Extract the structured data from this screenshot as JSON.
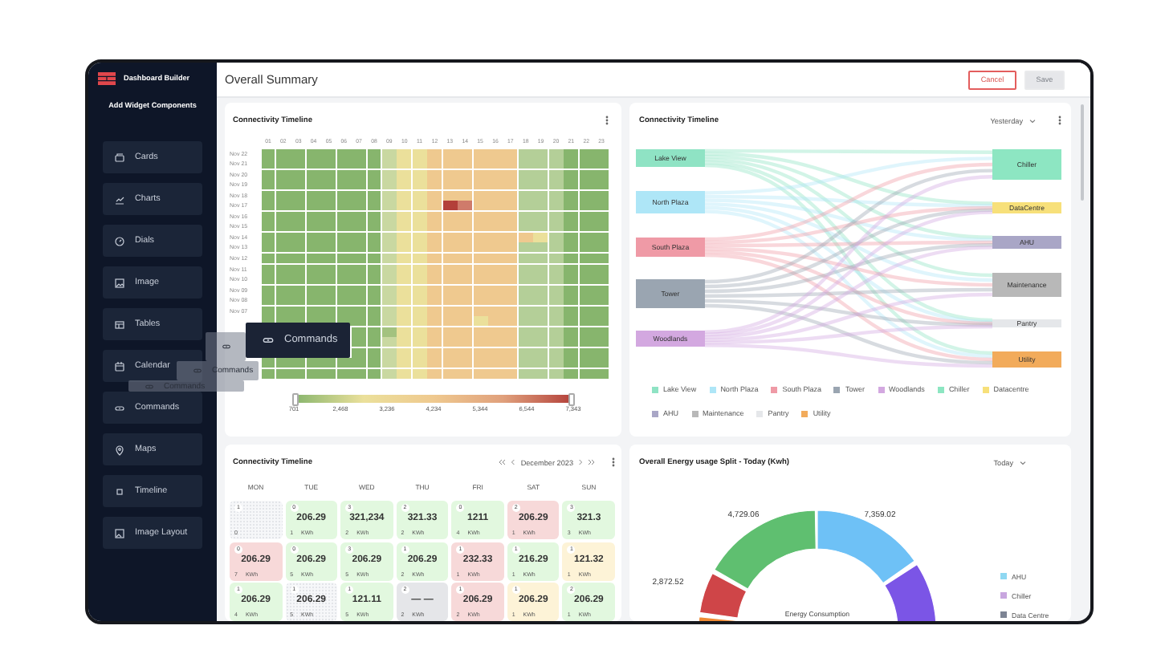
{
  "sidebar": {
    "app_title": "Dashboard Builder",
    "section_title": "Add Widget Components",
    "items": [
      {
        "label": "Cards",
        "kind": "cards"
      },
      {
        "label": "Charts",
        "kind": "charts"
      },
      {
        "label": "Dials",
        "kind": "dials"
      },
      {
        "label": "Image",
        "kind": "image"
      },
      {
        "label": "Tables",
        "kind": "tables"
      },
      {
        "label": "Calendar",
        "kind": "calendar"
      },
      {
        "label": "Commands",
        "kind": "commands"
      },
      {
        "label": "Maps",
        "kind": "maps"
      },
      {
        "label": "Timeline",
        "kind": "timeline"
      },
      {
        "label": "Image Layout",
        "kind": "layout"
      }
    ]
  },
  "header": {
    "title": "Overall Summary",
    "buttons": [
      {
        "label": "Cancel",
        "kind": "cancel",
        "disabled": false
      },
      {
        "label": "Save",
        "kind": "save",
        "disabled": true
      }
    ]
  },
  "heatmap_card": {
    "title": "Connectivity Timeline",
    "columns": [
      "01",
      "02",
      "03",
      "04",
      "05",
      "06",
      "07",
      "08",
      "09",
      "10",
      "11",
      "12",
      "13",
      "14",
      "15",
      "16",
      "17",
      "18",
      "19",
      "20",
      "21",
      "22",
      "23"
    ],
    "rows": [
      {
        "label": "Nov 22",
        "cells": [
          {
            "color": "#87b56d"
          },
          {
            "color": "#87b56d"
          },
          {
            "color": "#87b56d"
          },
          {
            "color": "#87b56d"
          },
          {
            "color": "#87b56d"
          },
          {
            "color": "#87b56d"
          },
          {
            "color": "#87b56d"
          },
          {
            "color": "#87b56d"
          },
          {
            "color": "#c9d8a1"
          },
          {
            "color": "#ebe09b"
          },
          {
            "color": "#ebe09b"
          },
          {
            "color": "#efc98f"
          },
          {
            "color": "#efc98f"
          },
          {
            "color": "#efc98f"
          },
          {
            "color": "#efc98f"
          },
          {
            "color": "#efc98f"
          },
          {
            "color": "#efc98f"
          },
          {
            "color": "#b4cf98"
          },
          {
            "color": "#b4cf98"
          },
          {
            "color": "#b4cf98"
          },
          {
            "color": "#87b56d"
          },
          {
            "color": "#87b56d"
          },
          {
            "color": "#87b56d"
          }
        ]
      },
      {
        "label": "Nov 21",
        "cells": [
          {
            "color": "#87b56d"
          },
          {
            "color": "#87b56d"
          },
          {
            "color": "#87b56d"
          },
          {
            "color": "#87b56d"
          },
          {
            "color": "#87b56d"
          },
          {
            "color": "#87b56d"
          },
          {
            "color": "#87b56d"
          },
          {
            "color": "#87b56d"
          },
          {
            "color": "#c9d8a1"
          },
          {
            "color": "#ebe09b"
          },
          {
            "color": "#ebe09b"
          },
          {
            "color": "#efc98f"
          },
          {
            "color": "#efc98f"
          },
          {
            "color": "#efc98f"
          },
          {
            "color": "#efc98f"
          },
          {
            "color": "#efc98f"
          },
          {
            "color": "#efc98f"
          },
          {
            "color": "#b4cf98"
          },
          {
            "color": "#b4cf98"
          },
          {
            "color": "#b4cf98"
          },
          {
            "color": "#87b56d"
          },
          {
            "color": "#87b56d"
          },
          {
            "color": "#87b56d"
          }
        ]
      },
      {
        "label": "Nov 20",
        "cells": [
          {
            "color": "#87b56d"
          },
          {
            "color": "#87b56d"
          },
          {
            "color": "#87b56d"
          },
          {
            "color": "#87b56d"
          },
          {
            "color": "#87b56d"
          },
          {
            "color": "#87b56d"
          },
          {
            "color": "#87b56d"
          },
          {
            "color": "#87b56d"
          },
          {
            "color": "#c9d8a1"
          },
          {
            "color": "#ebe09b"
          },
          {
            "color": "#ebe09b"
          },
          {
            "color": "#efc98f"
          },
          {
            "color": "#efc98f"
          },
          {
            "color": "#efc98f"
          },
          {
            "color": "#efc98f"
          },
          {
            "color": "#efc98f"
          },
          {
            "color": "#efc98f"
          },
          {
            "color": "#b4cf98"
          },
          {
            "color": "#b4cf98"
          },
          {
            "color": "#b4cf98"
          },
          {
            "color": "#87b56d"
          },
          {
            "color": "#87b56d"
          },
          {
            "color": "#87b56d"
          }
        ]
      },
      {
        "label": "Nov 19",
        "cells": [
          {
            "color": "#87b56d"
          },
          {
            "color": "#87b56d"
          },
          {
            "color": "#87b56d"
          },
          {
            "color": "#87b56d"
          },
          {
            "color": "#87b56d"
          },
          {
            "color": "#87b56d"
          },
          {
            "color": "#87b56d"
          },
          {
            "color": "#87b56d"
          },
          {
            "color": "#c9d8a1"
          },
          {
            "color": "#ebe09b"
          },
          {
            "color": "#ebe09b"
          },
          {
            "color": "#efc98f"
          },
          {
            "color": "#efc98f"
          },
          {
            "color": "#efc98f"
          },
          {
            "color": "#efc98f"
          },
          {
            "color": "#efc98f"
          },
          {
            "color": "#efc98f"
          },
          {
            "color": "#b4cf98"
          },
          {
            "color": "#b4cf98"
          },
          {
            "color": "#b4cf98"
          },
          {
            "color": "#87b56d"
          },
          {
            "color": "#87b56d"
          },
          {
            "color": "#87b56d"
          }
        ]
      },
      {
        "label": "Nov 18",
        "cells": [
          {
            "color": "#87b56d"
          },
          {
            "color": "#87b56d"
          },
          {
            "color": "#87b56d"
          },
          {
            "color": "#87b56d"
          },
          {
            "color": "#87b56d"
          },
          {
            "color": "#87b56d"
          },
          {
            "color": "#87b56d"
          },
          {
            "color": "#87b56d"
          },
          {
            "color": "#c9d8a1"
          },
          {
            "color": "#ebe09b"
          },
          {
            "color": "#ebe09b"
          },
          {
            "color": "#efc98f"
          },
          {
            "color": "#efc98f"
          },
          {
            "color": "#efc98f"
          },
          {
            "color": "#efc98f"
          },
          {
            "color": "#efc98f"
          },
          {
            "color": "#efc98f"
          },
          {
            "color": "#b4cf98"
          },
          {
            "color": "#b4cf98"
          },
          {
            "color": "#b4cf98"
          },
          {
            "color": "#87b56d"
          },
          {
            "color": "#87b56d"
          },
          {
            "color": "#87b56d"
          }
        ]
      },
      {
        "label": "Nov 17",
        "cells": [
          {
            "color": "#87b56d"
          },
          {
            "color": "#87b56d"
          },
          {
            "color": "#87b56d"
          },
          {
            "color": "#87b56d"
          },
          {
            "color": "#87b56d"
          },
          {
            "color": "#87b56d"
          },
          {
            "color": "#87b56d"
          },
          {
            "color": "#87b56d"
          },
          {
            "color": "#c9d8a1"
          },
          {
            "color": "#ebe09b"
          },
          {
            "color": "#ebe09b"
          },
          {
            "color": "#efc98f"
          },
          {
            "color": "#b3403a"
          },
          {
            "color": "#cf7b6b"
          },
          {
            "color": "#efc98f"
          },
          {
            "color": "#efc98f"
          },
          {
            "color": "#efc98f"
          },
          {
            "color": "#b4cf98"
          },
          {
            "color": "#b4cf98"
          },
          {
            "color": "#b4cf98"
          },
          {
            "color": "#87b56d"
          },
          {
            "color": "#87b56d"
          },
          {
            "color": "#87b56d"
          }
        ]
      },
      {
        "label": "Nov 16",
        "cells": [
          {
            "color": "#87b56d"
          },
          {
            "color": "#87b56d"
          },
          {
            "color": "#87b56d"
          },
          {
            "color": "#87b56d"
          },
          {
            "color": "#87b56d"
          },
          {
            "color": "#87b56d"
          },
          {
            "color": "#87b56d"
          },
          {
            "color": "#87b56d"
          },
          {
            "color": "#c9d8a1"
          },
          {
            "color": "#ebe09b"
          },
          {
            "color": "#ebe09b"
          },
          {
            "color": "#efc98f"
          },
          {
            "color": "#efc98f"
          },
          {
            "color": "#efc98f"
          },
          {
            "color": "#efc98f"
          },
          {
            "color": "#efc98f"
          },
          {
            "color": "#efc98f"
          },
          {
            "color": "#b4cf98"
          },
          {
            "color": "#b4cf98"
          },
          {
            "color": "#b4cf98"
          },
          {
            "color": "#87b56d"
          },
          {
            "color": "#87b56d"
          },
          {
            "color": "#87b56d"
          }
        ]
      },
      {
        "label": "Nov 15",
        "cells": [
          {
            "color": "#87b56d"
          },
          {
            "color": "#87b56d"
          },
          {
            "color": "#87b56d"
          },
          {
            "color": "#87b56d"
          },
          {
            "color": "#87b56d"
          },
          {
            "color": "#87b56d"
          },
          {
            "color": "#87b56d"
          },
          {
            "color": "#87b56d"
          },
          {
            "color": "#c9d8a1"
          },
          {
            "color": "#ebe09b"
          },
          {
            "color": "#ebe09b"
          },
          {
            "color": "#efc98f"
          },
          {
            "color": "#efc98f"
          },
          {
            "color": "#efc98f"
          },
          {
            "color": "#efc98f"
          },
          {
            "color": "#efc98f"
          },
          {
            "color": "#efc98f"
          },
          {
            "color": "#b4cf98"
          },
          {
            "color": "#b4cf98"
          },
          {
            "color": "#b4cf98"
          },
          {
            "color": "#87b56d"
          },
          {
            "color": "#87b56d"
          },
          {
            "color": "#87b56d"
          }
        ]
      },
      {
        "label": "Nov 14",
        "cells": [
          {
            "color": "#87b56d"
          },
          {
            "color": "#87b56d"
          },
          {
            "color": "#87b56d"
          },
          {
            "color": "#87b56d"
          },
          {
            "color": "#87b56d"
          },
          {
            "color": "#87b56d"
          },
          {
            "color": "#87b56d"
          },
          {
            "color": "#87b56d"
          },
          {
            "color": "#c9d8a1"
          },
          {
            "color": "#ebe09b"
          },
          {
            "color": "#ebe09b"
          },
          {
            "color": "#efc98f"
          },
          {
            "color": "#efc98f"
          },
          {
            "color": "#efc98f"
          },
          {
            "color": "#efc98f"
          },
          {
            "color": "#efc98f"
          },
          {
            "color": "#efc98f"
          },
          {
            "color": "#efc98f"
          },
          {
            "color": "#ebe09b"
          },
          {
            "color": "#b4cf98"
          },
          {
            "color": "#87b56d"
          },
          {
            "color": "#87b56d"
          },
          {
            "color": "#87b56d"
          }
        ]
      },
      {
        "label": "Nov 13",
        "cells": [
          {
            "color": "#87b56d"
          },
          {
            "color": "#87b56d"
          },
          {
            "color": "#87b56d"
          },
          {
            "color": "#87b56d"
          },
          {
            "color": "#87b56d"
          },
          {
            "color": "#87b56d"
          },
          {
            "color": "#87b56d"
          },
          {
            "color": "#87b56d"
          },
          {
            "color": "#c9d8a1"
          },
          {
            "color": "#ebe09b"
          },
          {
            "color": "#ebe09b"
          },
          {
            "color": "#efc98f"
          },
          {
            "color": "#efc98f"
          },
          {
            "color": "#efc98f"
          },
          {
            "color": "#efc98f"
          },
          {
            "color": "#efc98f"
          },
          {
            "color": "#efc98f"
          },
          {
            "color": "#b4cf98"
          },
          {
            "color": "#b4cf98"
          },
          {
            "color": "#b4cf98"
          },
          {
            "color": "#87b56d"
          },
          {
            "color": "#87b56d"
          },
          {
            "color": "#87b56d"
          }
        ]
      },
      {
        "label": "Nov 12",
        "cells": [
          {
            "color": "#87b56d"
          },
          {
            "color": "#87b56d"
          },
          {
            "color": "#87b56d"
          },
          {
            "color": "#87b56d"
          },
          {
            "color": "#87b56d"
          },
          {
            "color": "#87b56d"
          },
          {
            "color": "#87b56d"
          },
          {
            "color": "#87b56d"
          },
          {
            "color": "#c9d8a1"
          },
          {
            "color": "#ebe09b"
          },
          {
            "color": "#ebe09b"
          },
          {
            "color": "#efc98f"
          },
          {
            "color": "#efc98f"
          },
          {
            "color": "#efc98f"
          },
          {
            "color": "#efc98f"
          },
          {
            "color": "#efc98f"
          },
          {
            "color": "#efc98f"
          },
          {
            "color": "#b4cf98"
          },
          {
            "color": "#b4cf98"
          },
          {
            "color": "#b4cf98"
          },
          {
            "color": "#87b56d"
          },
          {
            "color": "#87b56d"
          },
          {
            "color": "#87b56d"
          }
        ]
      },
      {
        "label": "Nov 11",
        "cells": [
          {
            "color": "#87b56d"
          },
          {
            "color": "#87b56d"
          },
          {
            "color": "#87b56d"
          },
          {
            "color": "#87b56d"
          },
          {
            "color": "#87b56d"
          },
          {
            "color": "#87b56d"
          },
          {
            "color": "#87b56d"
          },
          {
            "color": "#87b56d"
          },
          {
            "color": "#c9d8a1"
          },
          {
            "color": "#ebe09b"
          },
          {
            "color": "#ebe09b"
          },
          {
            "color": "#efc98f"
          },
          {
            "color": "#efc98f"
          },
          {
            "color": "#efc98f"
          },
          {
            "color": "#efc98f"
          },
          {
            "color": "#efc98f"
          },
          {
            "color": "#efc98f"
          },
          {
            "color": "#b4cf98"
          },
          {
            "color": "#b4cf98"
          },
          {
            "color": "#b4cf98"
          },
          {
            "color": "#87b56d"
          },
          {
            "color": "#87b56d"
          },
          {
            "color": "#87b56d"
          }
        ]
      },
      {
        "label": "Nov 10",
        "cells": [
          {
            "color": "#87b56d"
          },
          {
            "color": "#87b56d"
          },
          {
            "color": "#87b56d"
          },
          {
            "color": "#87b56d"
          },
          {
            "color": "#87b56d"
          },
          {
            "color": "#87b56d"
          },
          {
            "color": "#87b56d"
          },
          {
            "color": "#87b56d"
          },
          {
            "color": "#c9d8a1"
          },
          {
            "color": "#ebe09b"
          },
          {
            "color": "#ebe09b"
          },
          {
            "color": "#efc98f"
          },
          {
            "color": "#efc98f"
          },
          {
            "color": "#efc98f"
          },
          {
            "color": "#efc98f"
          },
          {
            "color": "#efc98f"
          },
          {
            "color": "#efc98f"
          },
          {
            "color": "#b4cf98"
          },
          {
            "color": "#b4cf98"
          },
          {
            "color": "#b4cf98"
          },
          {
            "color": "#87b56d"
          },
          {
            "color": "#87b56d"
          },
          {
            "color": "#87b56d"
          }
        ]
      },
      {
        "label": "Nov 09",
        "cells": [
          {
            "color": "#87b56d"
          },
          {
            "color": "#87b56d"
          },
          {
            "color": "#87b56d"
          },
          {
            "color": "#87b56d"
          },
          {
            "color": "#87b56d"
          },
          {
            "color": "#87b56d"
          },
          {
            "color": "#87b56d"
          },
          {
            "color": "#87b56d"
          },
          {
            "color": "#c9d8a1"
          },
          {
            "color": "#ebe09b"
          },
          {
            "color": "#ebe09b"
          },
          {
            "color": "#efc98f"
          },
          {
            "color": "#efc98f"
          },
          {
            "color": "#efc98f"
          },
          {
            "color": "#efc98f"
          },
          {
            "color": "#efc98f"
          },
          {
            "color": "#efc98f"
          },
          {
            "color": "#b4cf98"
          },
          {
            "color": "#b4cf98"
          },
          {
            "color": "#b4cf98"
          },
          {
            "color": "#87b56d"
          },
          {
            "color": "#87b56d"
          },
          {
            "color": "#87b56d"
          }
        ]
      },
      {
        "label": "Nov 08",
        "cells": [
          {
            "color": "#87b56d"
          },
          {
            "color": "#87b56d"
          },
          {
            "color": "#87b56d"
          },
          {
            "color": "#87b56d"
          },
          {
            "color": "#87b56d"
          },
          {
            "color": "#87b56d"
          },
          {
            "color": "#87b56d"
          },
          {
            "color": "#87b56d"
          },
          {
            "color": "#c9d8a1"
          },
          {
            "color": "#ebe09b"
          },
          {
            "color": "#ebe09b"
          },
          {
            "color": "#efc98f"
          },
          {
            "color": "#efc98f"
          },
          {
            "color": "#efc98f"
          },
          {
            "color": "#efc98f"
          },
          {
            "color": "#efc98f"
          },
          {
            "color": "#efc98f"
          },
          {
            "color": "#b4cf98"
          },
          {
            "color": "#b4cf98"
          },
          {
            "color": "#b4cf98"
          },
          {
            "color": "#87b56d"
          },
          {
            "color": "#87b56d"
          },
          {
            "color": "#87b56d"
          }
        ]
      },
      {
        "label": "Nov 07",
        "cells": [
          {
            "color": "#87b56d"
          },
          {
            "color": "#87b56d"
          },
          {
            "color": "#87b56d"
          },
          {
            "color": "#87b56d"
          },
          {
            "color": "#87b56d"
          },
          {
            "color": "#87b56d"
          },
          {
            "color": "#87b56d"
          },
          {
            "color": "#87b56d"
          },
          {
            "color": "#c9d8a1"
          },
          {
            "color": "#ebe09b"
          },
          {
            "color": "#ebe09b"
          },
          {
            "color": "#efc98f"
          },
          {
            "color": "#efc98f"
          },
          {
            "color": "#efc98f"
          },
          {
            "color": "#efc98f"
          },
          {
            "color": "#efc98f"
          },
          {
            "color": "#efc98f"
          },
          {
            "color": "#b4cf98"
          },
          {
            "color": "#b4cf98"
          },
          {
            "color": "#b4cf98"
          },
          {
            "color": "#87b56d"
          },
          {
            "color": "#87b56d"
          },
          {
            "color": "#87b56d"
          }
        ]
      },
      {
        "cells": [
          {
            "color": "#87b56d"
          },
          {
            "color": "#87b56d"
          },
          {
            "color": "#87b56d"
          },
          {
            "color": "#87b56d"
          },
          {
            "color": "#87b56d"
          },
          {
            "color": "#87b56d"
          },
          {
            "color": "#87b56d"
          },
          {
            "color": "#87b56d"
          },
          {
            "color": "#c9d8a1"
          },
          {
            "color": "#ebe09b"
          },
          {
            "color": "#ebe09b"
          },
          {
            "color": "#efc98f"
          },
          {
            "color": "#efc98f"
          },
          {
            "color": "#efc98f"
          },
          {
            "color": "#ebe09b"
          },
          {
            "color": "#efc98f"
          },
          {
            "color": "#efc98f"
          },
          {
            "color": "#b4cf98"
          },
          {
            "color": "#b4cf98"
          },
          {
            "color": "#b4cf98"
          },
          {
            "color": "#87b56d"
          },
          {
            "color": "#87b56d"
          },
          {
            "color": "#87b56d"
          }
        ]
      },
      {
        "cells": [
          null,
          null,
          null,
          null,
          null,
          null,
          {
            "color": "#87b56d"
          },
          {
            "color": "#87b56d"
          },
          {
            "color": "#a3c27f"
          },
          {
            "color": "#ebe09b"
          },
          {
            "color": "#ebe09b"
          },
          {
            "color": "#efc98f"
          },
          {
            "color": "#efc98f"
          },
          {
            "color": "#efc98f"
          },
          {
            "color": "#efc98f"
          },
          {
            "color": "#efc98f"
          },
          {
            "color": "#efc98f"
          },
          {
            "color": "#b4cf98"
          },
          {
            "color": "#b4cf98"
          },
          {
            "color": "#b4cf98"
          },
          {
            "color": "#87b56d"
          },
          {
            "color": "#87b56d"
          },
          {
            "color": "#87b56d"
          }
        ]
      },
      {
        "cells": [
          null,
          null,
          null,
          null,
          null,
          null,
          {
            "color": "#87b56d"
          },
          {
            "color": "#87b56d"
          },
          {
            "color": "#c9d8a1"
          },
          {
            "color": "#ebe09b"
          },
          {
            "color": "#ebe09b"
          },
          {
            "color": "#efc98f"
          },
          {
            "color": "#efc98f"
          },
          {
            "color": "#efc98f"
          },
          {
            "color": "#efc98f"
          },
          {
            "color": "#efc98f"
          },
          {
            "color": "#efc98f"
          },
          {
            "color": "#b4cf98"
          },
          {
            "color": "#b4cf98"
          },
          {
            "color": "#b4cf98"
          },
          {
            "color": "#87b56d"
          },
          {
            "color": "#87b56d"
          },
          {
            "color": "#87b56d"
          }
        ]
      },
      {
        "cells": [
          null,
          null,
          null,
          null,
          null,
          null,
          {
            "color": "#87b56d"
          },
          {
            "color": "#87b56d"
          },
          {
            "color": "#c9d8a1"
          },
          {
            "color": "#ebe09b"
          },
          {
            "color": "#ebe09b"
          },
          {
            "color": "#efc98f"
          },
          {
            "color": "#efc98f"
          },
          {
            "color": "#efc98f"
          },
          {
            "color": "#efc98f"
          },
          {
            "color": "#efc98f"
          },
          {
            "color": "#efc98f"
          },
          {
            "color": "#b4cf98"
          },
          {
            "color": "#b4cf98"
          },
          {
            "color": "#b4cf98"
          },
          {
            "color": "#87b56d"
          },
          {
            "color": "#87b56d"
          },
          {
            "color": "#87b56d"
          }
        ]
      },
      {
        "cells": [
          {
            "color": "#87b56d"
          },
          {
            "color": "#87b56d"
          },
          {
            "color": "#87b56d"
          },
          {
            "color": "#87b56d"
          },
          {
            "color": "#87b56d"
          },
          {
            "color": "#87b56d"
          },
          {
            "color": "#87b56d"
          },
          {
            "color": "#87b56d"
          },
          {
            "color": "#c9d8a1"
          },
          {
            "color": "#ebe09b"
          },
          {
            "color": "#ebe09b"
          },
          {
            "color": "#efc98f"
          },
          {
            "color": "#efc98f"
          },
          {
            "color": "#efc98f"
          },
          {
            "color": "#efc98f"
          },
          {
            "color": "#efc98f"
          },
          {
            "color": "#efc98f"
          },
          {
            "color": "#b4cf98"
          },
          {
            "color": "#b4cf98"
          },
          {
            "color": "#b4cf98"
          },
          {
            "color": "#87b56d"
          },
          {
            "color": "#87b56d"
          },
          {
            "color": "#87b56d"
          }
        ]
      },
      {
        "cells": [
          {
            "color": "#87b56d"
          },
          {
            "color": "#87b56d"
          },
          {
            "color": "#87b56d"
          },
          {
            "color": "#87b56d"
          },
          {
            "color": "#87b56d"
          },
          {
            "color": "#87b56d"
          },
          {
            "color": "#87b56d"
          },
          {
            "color": "#87b56d"
          },
          {
            "color": "#c9d8a1"
          },
          {
            "color": "#ebe09b"
          },
          {
            "color": "#ebe09b"
          },
          {
            "color": "#efc98f"
          },
          {
            "color": "#efc98f"
          },
          {
            "color": "#efc98f"
          },
          {
            "color": "#efc98f"
          },
          {
            "color": "#efc98f"
          },
          {
            "color": "#efc98f"
          },
          {
            "color": "#b4cf98"
          },
          {
            "color": "#b4cf98"
          },
          {
            "color": "#b4cf98"
          },
          {
            "color": "#87b56d"
          },
          {
            "color": "#87b56d"
          },
          {
            "color": "#87b56d"
          }
        ]
      }
    ],
    "scale": {
      "ticks": [
        "701",
        "2,468",
        "3,236",
        "4,234",
        "5,344",
        "6,544",
        "7,343"
      ]
    }
  },
  "sankey_card": {
    "title": "Connectivity Timeline",
    "period": "Yesterday",
    "sources": [
      {
        "label": "Lake View",
        "color": "#8fe3c4"
      },
      {
        "label": "North Plaza",
        "color": "#aee6f7"
      },
      {
        "label": "South Plaza",
        "color": "#ef9aa6"
      },
      {
        "label": "Tower",
        "color": "#9aa5b1"
      },
      {
        "label": "Woodlands",
        "color": "#d3a8e0"
      }
    ],
    "targets": [
      {
        "label": "Chiller",
        "color": "#8de6c2"
      },
      {
        "label": "DataCentre",
        "color": "#f7e07a"
      },
      {
        "label": "AHU",
        "color": "#a9a6c6"
      },
      {
        "label": "Maintenance",
        "color": "#b8b8b8"
      },
      {
        "label": "Pantry",
        "color": "#e5e7ea"
      },
      {
        "label": "Utility",
        "color": "#f2ab5b"
      }
    ],
    "legend": [
      {
        "label": "Lake View",
        "color": "#8fe3c4"
      },
      {
        "label": "North Plaza",
        "color": "#aee6f7"
      },
      {
        "label": "South Plaza",
        "color": "#ef9aa6"
      },
      {
        "label": "Tower",
        "color": "#9aa5b1"
      },
      {
        "label": "Woodlands",
        "color": "#d3a8e0"
      },
      {
        "label": "Chiller",
        "color": "#8de6c2"
      },
      {
        "label": "Datacentre",
        "color": "#f7e07a"
      },
      {
        "label": "AHU",
        "color": "#a9a6c6"
      },
      {
        "label": "Maintenance",
        "color": "#b8b8b8"
      },
      {
        "label": "Pantry",
        "color": "#e5e7ea"
      },
      {
        "label": "Utility",
        "color": "#f2ab5b"
      }
    ]
  },
  "calendar_card": {
    "title": "Connectivity Timeline",
    "month": "December 2023",
    "weekdays": [
      "MON",
      "TUE",
      "WED",
      "THU",
      "FRI",
      "SAT",
      "SUN"
    ],
    "weeks": [
      {
        "days": [
          {
            "day": "1",
            "count": "0",
            "kind": "empty"
          },
          {
            "day": "0",
            "value": "206.29",
            "count": "1",
            "unit": "KWh",
            "kind": "normal"
          },
          {
            "day": "3",
            "value": "321,234",
            "count": "2",
            "unit": "KWh",
            "kind": "normal"
          },
          {
            "day": "2",
            "value": "321.33",
            "count": "2",
            "unit": "KWh",
            "kind": "normal"
          },
          {
            "day": "0",
            "value": "1211",
            "count": "4",
            "unit": "KWh",
            "kind": "normal"
          },
          {
            "day": "2",
            "value": "206.29",
            "count": "1",
            "unit": "KWh",
            "kind": "high"
          },
          {
            "day": "3",
            "value": "321.3",
            "count": "3",
            "unit": "KWh",
            "kind": "normal"
          }
        ]
      },
      {
        "days": [
          {
            "day": "0",
            "value": "206.29",
            "count": "7",
            "unit": "KWh",
            "kind": "high"
          },
          {
            "day": "0",
            "value": "206.29",
            "count": "5",
            "unit": "KWh",
            "kind": "normal"
          },
          {
            "day": "3",
            "value": "206.29",
            "count": "5",
            "unit": "KWh",
            "kind": "normal"
          },
          {
            "day": "1",
            "value": "206.29",
            "count": "2",
            "unit": "KWh",
            "kind": "normal"
          },
          {
            "day": "1",
            "value": "232.33",
            "count": "1",
            "unit": "KWh",
            "kind": "high"
          },
          {
            "day": "1",
            "value": "216.29",
            "count": "1",
            "unit": "KWh",
            "kind": "normal"
          },
          {
            "day": "1",
            "value": "121.32",
            "count": "1",
            "unit": "KWh",
            "kind": "warning"
          }
        ]
      },
      {
        "days": [
          {
            "day": "1",
            "value": "206.29",
            "count": "4",
            "unit": "KWh",
            "kind": "normal"
          },
          {
            "day": "1",
            "value": "206.29",
            "count": "5",
            "unit": "KWh",
            "kind": "empty"
          },
          {
            "day": "1",
            "value": "121.11",
            "count": "5",
            "unit": "KWh",
            "kind": "normal"
          },
          {
            "day": "2",
            "value": "— —",
            "count": "2",
            "unit": "KWh",
            "kind": "none"
          },
          {
            "day": "1",
            "value": "206.29",
            "count": "2",
            "unit": "KWh",
            "kind": "high"
          },
          {
            "day": "1",
            "value": "206.29",
            "count": "1",
            "unit": "KWh",
            "kind": "warning"
          },
          {
            "day": "2",
            "value": "206.29",
            "count": "1",
            "unit": "KWh",
            "kind": "normal"
          }
        ]
      }
    ]
  },
  "donut_card": {
    "title": "Overall Energy usage Split - Today (Kwh)",
    "period": "Today",
    "center_label": "Energy Consumption",
    "slices": [
      {
        "color": "#6ec1f6",
        "label": "7,359.02"
      },
      {
        "color": "#7b55e6"
      },
      {
        "color": "#ef8a34"
      },
      {
        "color": "#cf4548",
        "label": "2,872.52"
      },
      {
        "color": "#5fbf70",
        "label": "4,729.06"
      }
    ],
    "legend": [
      {
        "label": "AHU",
        "color": "#8fd8f2"
      },
      {
        "label": "Chiller",
        "color": "#c8a6df"
      },
      {
        "label": "Data Centre",
        "color": "#7d8494"
      }
    ]
  },
  "drag_preview": [
    {
      "kind": "tile",
      "label": "Commands"
    },
    {
      "kind": "ghost"
    },
    {
      "kind": "ghost",
      "label": "Commands"
    },
    {
      "kind": "ghost",
      "label": "Commands"
    }
  ]
}
